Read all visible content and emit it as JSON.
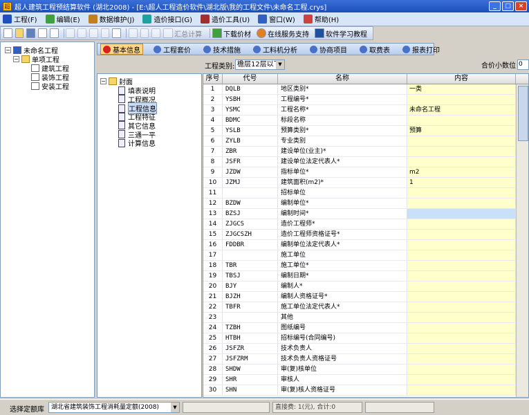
{
  "window": {
    "title": "超人建筑工程预结算软件 (湖北2008) - [E:\\超人工程造价软件\\湖北版\\我的工程文件\\未命名工程.crys]",
    "minimize": "_",
    "maximize": "□",
    "close": "×"
  },
  "menu": [
    {
      "label": "工程(F)",
      "icon": "project-icon",
      "color": "#2050c0"
    },
    {
      "label": "编辑(E)",
      "icon": "edit-icon",
      "color": "#40a040"
    },
    {
      "label": "数据维护(J)",
      "icon": "data-maintenance-icon",
      "color": "#c08020"
    },
    {
      "label": "造价接口(G)",
      "icon": "cost-interface-icon",
      "color": "#20a0a0"
    },
    {
      "label": "造价工具(U)",
      "icon": "cost-tools-icon",
      "color": "#a03030"
    },
    {
      "label": "窗口(W)",
      "icon": "window-icon",
      "color": "#3060c0"
    },
    {
      "label": "帮助(H)",
      "icon": "help-icon",
      "color": "#d04040"
    }
  ],
  "toolbar": {
    "calc_label": "汇总计算",
    "download_label": "下载价材",
    "online_label": "在线服务支持",
    "learn_label": "软件学习教程"
  },
  "project_tree": {
    "root": "未命名工程",
    "group": "单项工程",
    "items": [
      "建筑工程",
      "装饰工程",
      "安装工程"
    ]
  },
  "tabs": [
    "基本信息",
    "工程套价",
    "技术措施",
    "工料机分析",
    "协商项目",
    "取费表",
    "报表打印"
  ],
  "selector": {
    "label": "工程类别:",
    "value": "檐层12层以下",
    "decimal_label": "合价小数位",
    "decimal_value": "0"
  },
  "category_tree": {
    "root": "封面",
    "items": [
      "填表说明",
      "工程概况",
      "工程信息",
      "工程特征",
      "其它信息",
      "三通一平",
      "计算信息"
    ],
    "selected_index": 2
  },
  "grid": {
    "headers": {
      "num": "序号",
      "code": "代号",
      "name": "名称",
      "value": "内容"
    },
    "selected_row": 12,
    "rows": [
      {
        "num": "1",
        "code": "DQLB",
        "name": "地区类别*",
        "value": "一类"
      },
      {
        "num": "2",
        "code": "YSBH",
        "name": "工程编号*",
        "value": ""
      },
      {
        "num": "3",
        "code": "YSMC",
        "name": "工程名称*",
        "value": "未命名工程"
      },
      {
        "num": "4",
        "code": "BDMC",
        "name": "标段名称",
        "value": ""
      },
      {
        "num": "5",
        "code": "YSLB",
        "name": "预算类别*",
        "value": "预算"
      },
      {
        "num": "6",
        "code": "ZYLB",
        "name": "专业类别",
        "value": ""
      },
      {
        "num": "7",
        "code": "ZBR",
        "name": "建设单位(业主)*",
        "value": ""
      },
      {
        "num": "8",
        "code": "JSFR",
        "name": "建设单位法定代表人*",
        "value": ""
      },
      {
        "num": "9",
        "code": "JZDW",
        "name": "指标单位*",
        "value": "m2"
      },
      {
        "num": "10",
        "code": "JZMJ",
        "name": "建筑面积(m2)*",
        "value": "1"
      },
      {
        "num": "11",
        "code": "",
        "name": "招标单位",
        "value": ""
      },
      {
        "num": "12",
        "code": "BZDW",
        "name": "编制单位*",
        "value": ""
      },
      {
        "num": "13",
        "code": "BZSJ",
        "name": "编制时间*",
        "value": ""
      },
      {
        "num": "14",
        "code": "ZJGCS",
        "name": "造价工程师*",
        "value": ""
      },
      {
        "num": "15",
        "code": "ZJGCSZH",
        "name": "造价工程师资格证号*",
        "value": ""
      },
      {
        "num": "16",
        "code": "FDDBR",
        "name": "编制单位法定代表人*",
        "value": ""
      },
      {
        "num": "17",
        "code": "",
        "name": "施工单位",
        "value": ""
      },
      {
        "num": "18",
        "code": "TBR",
        "name": "施工单位*",
        "value": ""
      },
      {
        "num": "19",
        "code": "TBSJ",
        "name": "编制日期*",
        "value": ""
      },
      {
        "num": "20",
        "code": "BJY",
        "name": "编制人*",
        "value": ""
      },
      {
        "num": "21",
        "code": "BJZH",
        "name": "编制人资格证号*",
        "value": ""
      },
      {
        "num": "22",
        "code": "TBFR",
        "name": "施工单位法定代表人*",
        "value": ""
      },
      {
        "num": "23",
        "code": "",
        "name": "其他",
        "value": ""
      },
      {
        "num": "24",
        "code": "TZBH",
        "name": "图纸编号",
        "value": ""
      },
      {
        "num": "25",
        "code": "HTBH",
        "name": "招标编号(合同编号)",
        "value": ""
      },
      {
        "num": "26",
        "code": "JSFZR",
        "name": "技术负责人",
        "value": ""
      },
      {
        "num": "27",
        "code": "JSFZRM",
        "name": "技术负责人资格证号",
        "value": ""
      },
      {
        "num": "28",
        "code": "SHDW",
        "name": "审(复)核单位",
        "value": ""
      },
      {
        "num": "29",
        "code": "SHR",
        "name": "审核人",
        "value": ""
      },
      {
        "num": "30",
        "code": "SHN",
        "name": "审(复)核人资格证号",
        "value": ""
      }
    ]
  },
  "status": {
    "label": "选择定额库",
    "library": "湖北省建筑装饰工程消耗量定额(2008)",
    "info": "直接费: 1(元), 合计:0"
  }
}
